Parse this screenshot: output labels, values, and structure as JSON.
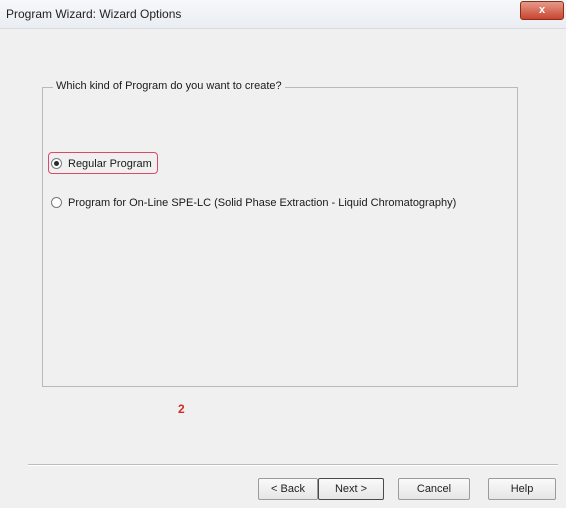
{
  "window": {
    "title": "Program Wizard: Wizard Options",
    "close_label": "x"
  },
  "group": {
    "legend": "Which kind of Program do you want to create?",
    "options": [
      {
        "label": "Regular Program",
        "selected": true
      },
      {
        "label": "Program for On-Line SPE-LC (Solid Phase Extraction - Liquid Chromatography)",
        "selected": false
      }
    ]
  },
  "annotation": "2",
  "buttons": {
    "back": "< Back",
    "next": "Next >",
    "cancel": "Cancel",
    "help": "Help"
  },
  "colors": {
    "highlight": "#d94a6a",
    "annotation": "#d02b2b",
    "close_button": "#c9462f"
  }
}
